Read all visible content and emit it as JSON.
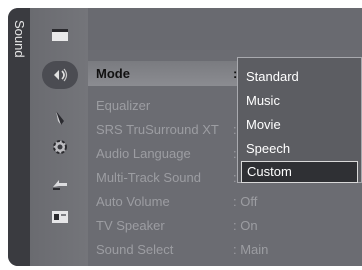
{
  "sidebar": {
    "title": "Sound"
  },
  "menu": {
    "items": [
      {
        "label": "Mode",
        "value": ":"
      },
      {
        "label": "Equalizer",
        "value": ""
      },
      {
        "label": "SRS TruSurround XT",
        "value": ":"
      },
      {
        "label": "Audio Language",
        "value": ":"
      },
      {
        "label": "Multi-Track Sound",
        "value": ":"
      },
      {
        "label": "Auto Volume",
        "value": ": Off"
      },
      {
        "label": "TV Speaker",
        "value": ": On"
      },
      {
        "label": "Sound Select",
        "value": ": Main"
      }
    ]
  },
  "dropdown": {
    "options": [
      "Standard",
      "Music",
      "Movie",
      "Speech",
      "Custom"
    ],
    "selected": "Custom"
  },
  "icons": [
    "picture-icon",
    "sound-icon",
    "channel-icon",
    "setup-icon",
    "input-icon",
    "application-icon"
  ]
}
